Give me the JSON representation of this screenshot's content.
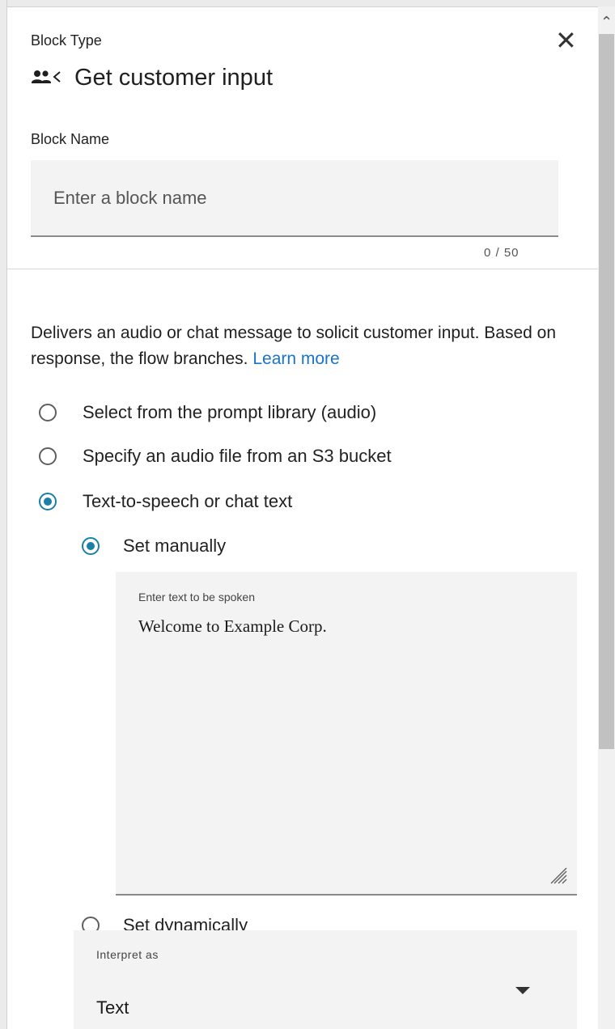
{
  "header": {
    "block_type_label": "Block Type",
    "close_icon": "close-icon",
    "block_icon": "customer-input-icon",
    "title": "Get customer input"
  },
  "block_name": {
    "label": "Block Name",
    "placeholder": "Enter a block name",
    "value": "",
    "counter": "0 / 50"
  },
  "description": {
    "text": "Delivers an audio or chat message to solicit customer input. Based on response, the flow branches.",
    "link": "Learn more"
  },
  "prompt_options": [
    {
      "label": "Select from the prompt library (audio)",
      "checked": false
    },
    {
      "label": "Specify an audio file from an S3 bucket",
      "checked": false
    },
    {
      "label": "Text-to-speech or chat text",
      "checked": true
    }
  ],
  "tts_options": [
    {
      "label": "Set manually",
      "checked": true
    },
    {
      "label": "Set dynamically",
      "checked": false
    }
  ],
  "text_to_speak": {
    "label": "Enter text to be spoken",
    "value": "Welcome to Example Corp."
  },
  "interpret_as": {
    "label": "Interpret as",
    "value": "Text"
  },
  "colors": {
    "accent": "#1c7fa8",
    "link": "#1a73c8",
    "field_bg": "#f3f3f3"
  }
}
